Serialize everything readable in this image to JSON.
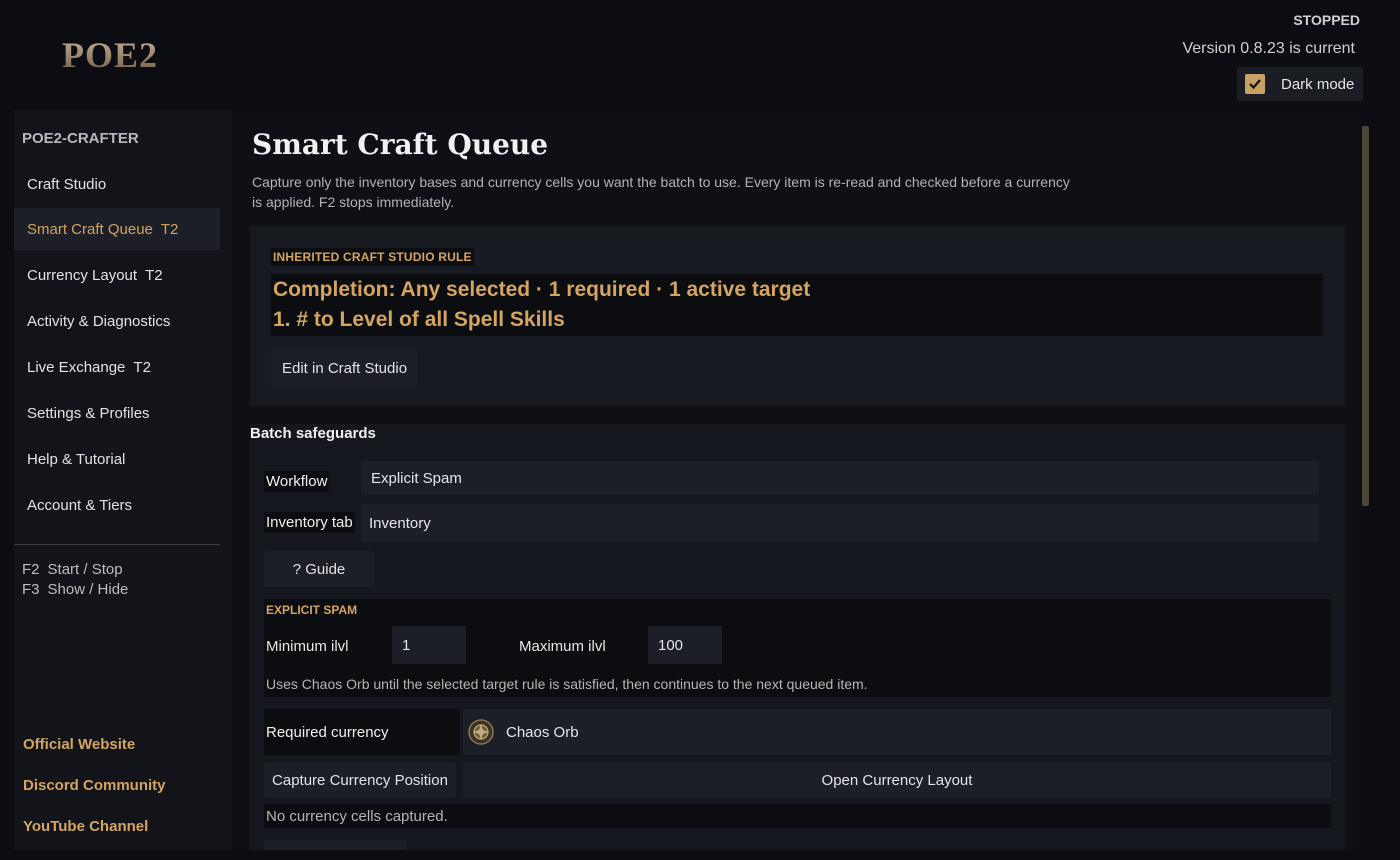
{
  "header": {
    "logo": "POE2",
    "status": "STOPPED",
    "version": "Version 0.8.23 is current",
    "dark_mode_label": "Dark mode",
    "dark_mode_checked": true
  },
  "sidebar": {
    "app_name": "POE2-CRAFTER",
    "items": [
      {
        "label": "Craft Studio",
        "badge": ""
      },
      {
        "label": "Smart Craft Queue",
        "badge": "T2"
      },
      {
        "label": "Currency Layout",
        "badge": "T2"
      },
      {
        "label": "Activity & Diagnostics",
        "badge": ""
      },
      {
        "label": "Live Exchange",
        "badge": "T2"
      },
      {
        "label": "Settings & Profiles",
        "badge": ""
      },
      {
        "label": "Help & Tutorial",
        "badge": ""
      },
      {
        "label": "Account & Tiers",
        "badge": ""
      }
    ],
    "shortcuts": [
      {
        "key": "F2",
        "action": "Start / Stop"
      },
      {
        "key": "F3",
        "action": "Show / Hide"
      }
    ],
    "links": [
      "Official Website",
      "Discord Community",
      "YouTube Channel"
    ]
  },
  "main": {
    "title": "Smart Craft Queue",
    "description": "Capture only the inventory bases and currency cells you want the batch to use. Every item is re-read and checked before a currency is applied. F2 stops immediately.",
    "rule": {
      "label": "INHERITED CRAFT STUDIO RULE",
      "completion": "Completion: Any selected · 1 required · 1 active target",
      "target": "1. # to Level of all Spell Skills",
      "edit_button": "Edit in Craft Studio"
    },
    "safeguards": {
      "title": "Batch safeguards",
      "workflow_label": "Workflow",
      "workflow_value": "Explicit Spam",
      "inventory_label": "Inventory tab",
      "inventory_value": "Inventory",
      "guide_button": "? Guide",
      "spam": {
        "label": "EXPLICIT SPAM",
        "min_label": "Minimum ilvl",
        "min_value": "1",
        "max_label": "Maximum ilvl",
        "max_value": "100",
        "note": "Uses Chaos Orb until the selected target rule is satisfied, then continues to the next queued item."
      },
      "required_currency_label": "Required currency",
      "required_currency_value": "Chaos Orb",
      "capture_button": "Capture Currency Position",
      "open_layout_button": "Open Currency Layout",
      "no_cells": "No currency cells captured."
    }
  },
  "colors": {
    "accent": "#d4a463",
    "background": "#0b0d12",
    "panel": "#171a21"
  }
}
